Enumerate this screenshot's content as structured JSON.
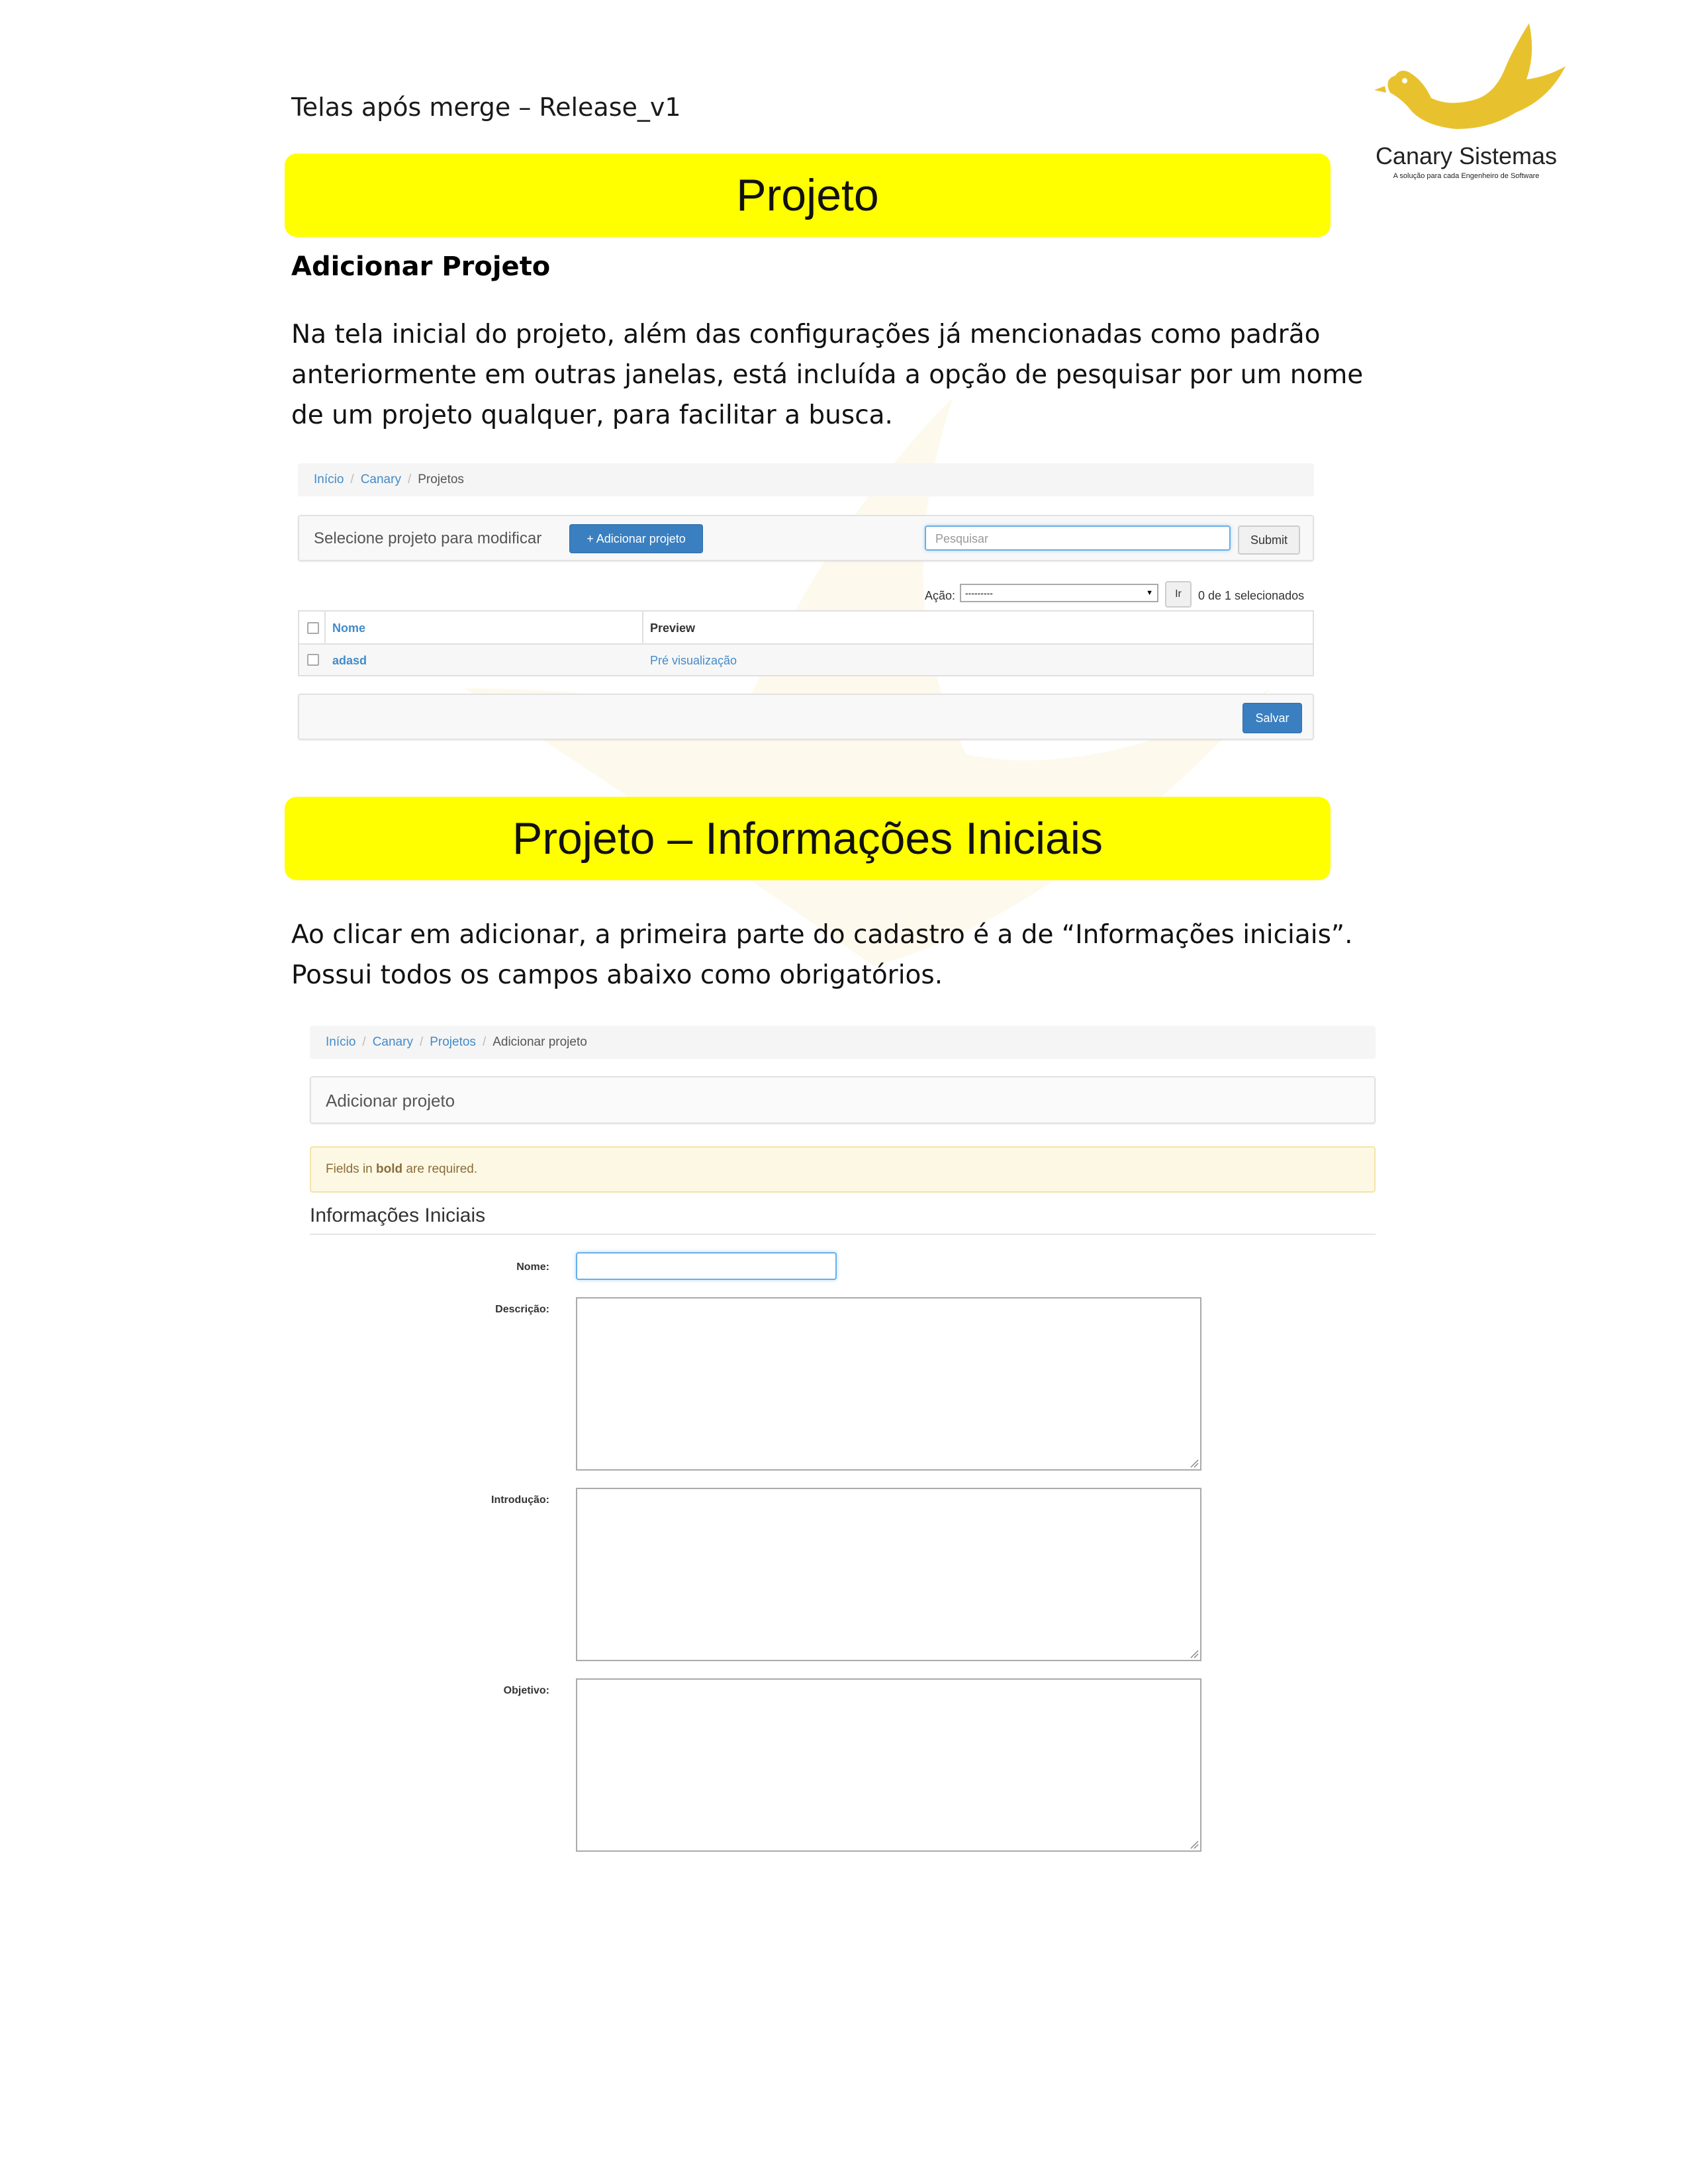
{
  "header": {
    "doc_title": "Telas após merge – Release_v1",
    "logo_name": "Canary Sistemas",
    "logo_tagline": "A solução para cada Engenheiro de Software"
  },
  "section1": {
    "banner": "Projeto",
    "subtitle": "Adicionar Projeto",
    "paragraph": "Na tela inicial do projeto, além das configurações já mencionadas como padrão anteriormente em outras janelas, está incluída a opção de pesquisar por um nome de um projeto qualquer, para facilitar a busca."
  },
  "screen1": {
    "breadcrumb": [
      "Início",
      "Canary",
      "Projetos"
    ],
    "panel_title": "Selecione projeto para modificar",
    "add_button": "+ Adicionar projeto",
    "search_placeholder": "Pesquisar",
    "submit_button": "Submit",
    "action_label": "Ação:",
    "action_value": "---------",
    "go_button": "Ir",
    "selected_count": "0 de 1 selecionados",
    "columns": [
      "Nome",
      "Preview"
    ],
    "rows": [
      {
        "name": "adasd",
        "preview": "Pré visualização"
      }
    ],
    "save_button": "Salvar"
  },
  "section2": {
    "banner": "Projeto – Informações Iniciais",
    "paragraph": "Ao clicar em adicionar, a primeira parte do cadastro é a de “Informações iniciais”. Possui todos os campos abaixo como obrigatórios."
  },
  "screen2": {
    "breadcrumb": [
      "Início",
      "Canary",
      "Projetos",
      "Adicionar projeto"
    ],
    "panel_title": "Adicionar projeto",
    "notice_prefix": "Fields in",
    "notice_bold": "bold",
    "notice_suffix": "are required.",
    "fieldset_title": "Informações Iniciais",
    "fields": {
      "nome": "Nome:",
      "descricao": "Descrição:",
      "introducao": "Introdução:",
      "objetivo": "Objetivo:"
    }
  },
  "colors": {
    "banner_yellow": "#ffff00",
    "logo_gold": "#e8c22e",
    "link_blue": "#428bca",
    "button_blue": "#3a7fc0"
  }
}
